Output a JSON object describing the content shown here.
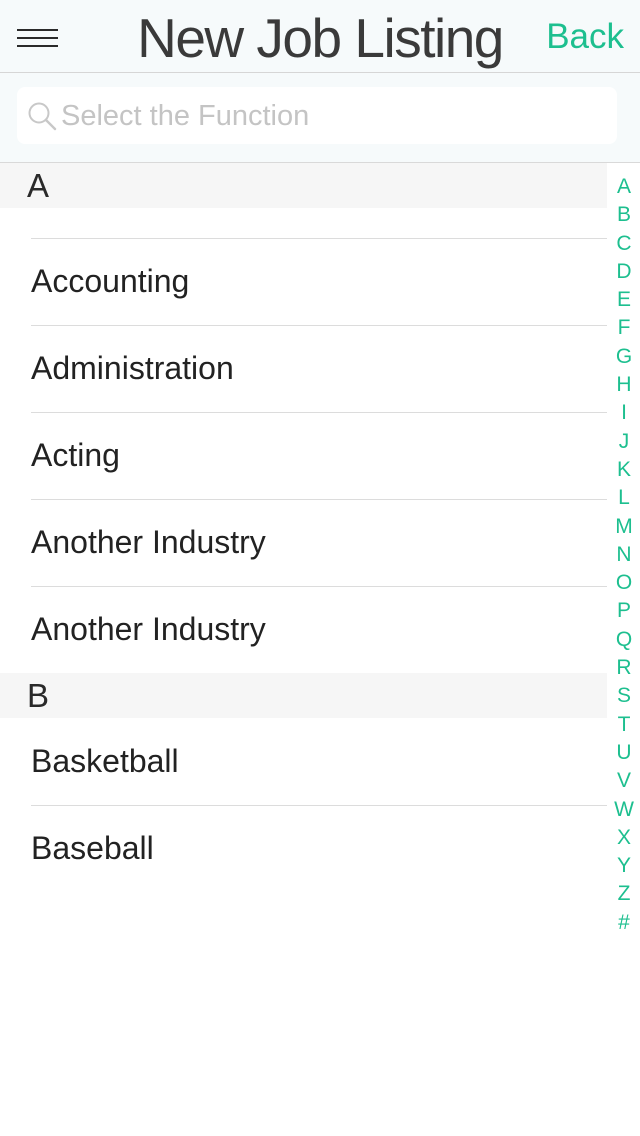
{
  "nav": {
    "title": "New Job Listing",
    "back_label": "Back"
  },
  "search": {
    "placeholder": "Select the Function",
    "value": ""
  },
  "sections": [
    {
      "header": "A",
      "items": [
        "Accounting",
        "Administration",
        "Acting",
        "Another Industry",
        "Another Industry"
      ]
    },
    {
      "header": "B",
      "items": [
        "Basketball",
        "Baseball"
      ]
    }
  ],
  "index_letters": [
    "A",
    "B",
    "C",
    "D",
    "E",
    "F",
    "G",
    "H",
    "I",
    "J",
    "K",
    "L",
    "M",
    "N",
    "O",
    "P",
    "Q",
    "R",
    "S",
    "T",
    "U",
    "V",
    "W",
    "X",
    "Y",
    "Z",
    "#"
  ],
  "colors": {
    "accent": "#1dbf8f",
    "navbar_bg": "#f6fafb",
    "section_bg": "#f6f6f6"
  },
  "icons": {
    "menu": "hamburger-menu-icon",
    "search": "search-icon"
  }
}
